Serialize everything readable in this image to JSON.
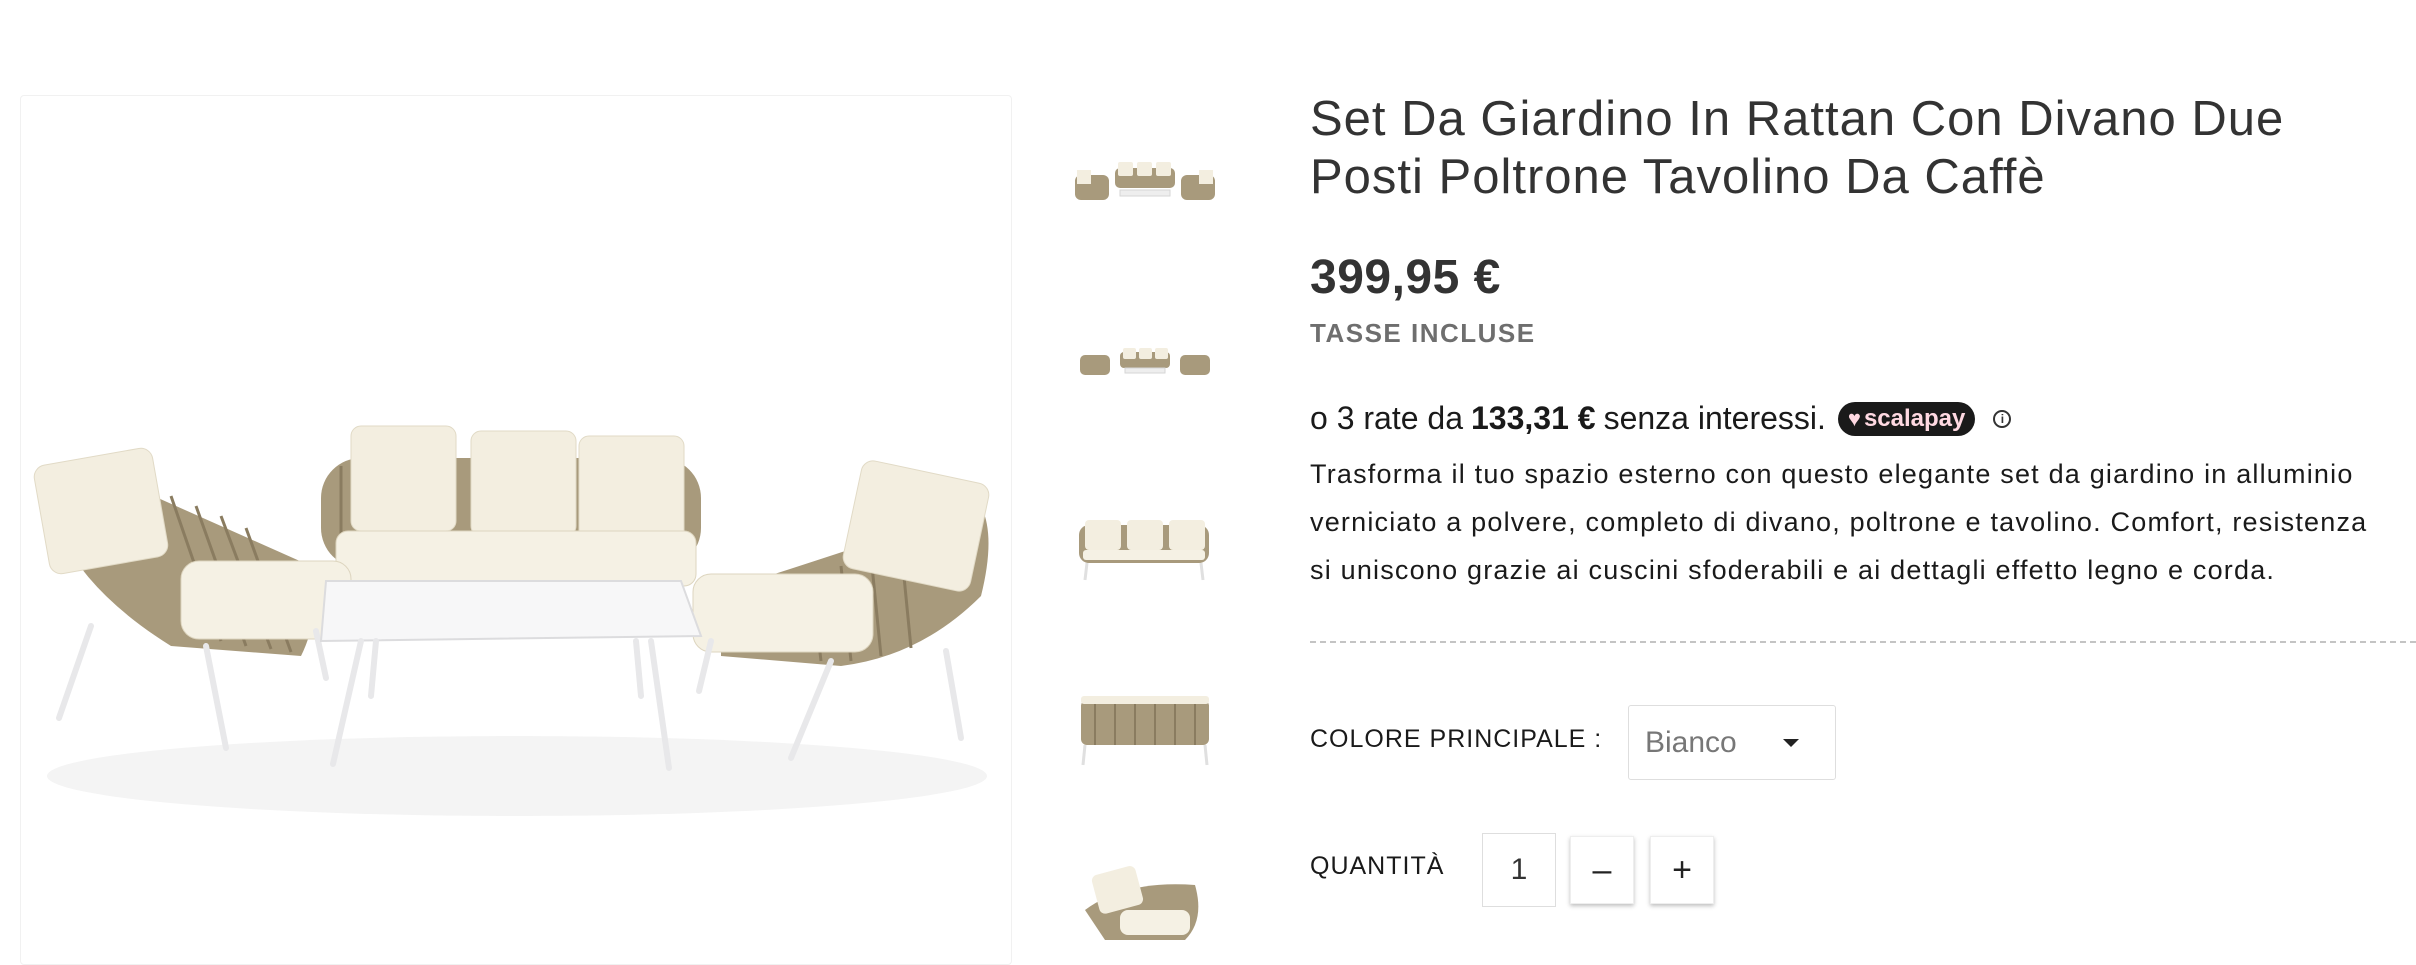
{
  "product": {
    "title": "Set Da Giardino In Rattan Con Divano Due Posti Poltrone Tavolino Da Caffè",
    "price": "399,95 €",
    "tax_note": "TASSE INCLUSE",
    "installments": {
      "prefix": "o 3 rate da",
      "amount": "133,31 €",
      "suffix": "senza interessi.",
      "provider": "scalapay"
    },
    "description_lines": [
      "Trasforma il tuo spazio esterno con questo elegante set da giardino in alluminio",
      "verniciato a polvere, completo di divano, poltrone e tavolino. Comfort, resistenza",
      "si uniscono grazie ai cuscini sfoderabili e ai dettagli effetto legno e corda."
    ]
  },
  "options": {
    "color_label": "COLORE PRINCIPALE :",
    "color_selected": "Bianco",
    "quantity_label": "QUANTITÀ",
    "quantity_value": "1",
    "minus": "–",
    "plus": "+"
  },
  "icons": {
    "select_caret": "chevron-down-icon",
    "info": "info-icon",
    "scalapay_heart": "heart-icon"
  },
  "colors": {
    "text": "#333333",
    "scalapay_bg": "#1a1a1a",
    "scalapay_text": "#ffd9e2",
    "rattan": "#a89a7c",
    "cushion": "#f3eee0"
  }
}
